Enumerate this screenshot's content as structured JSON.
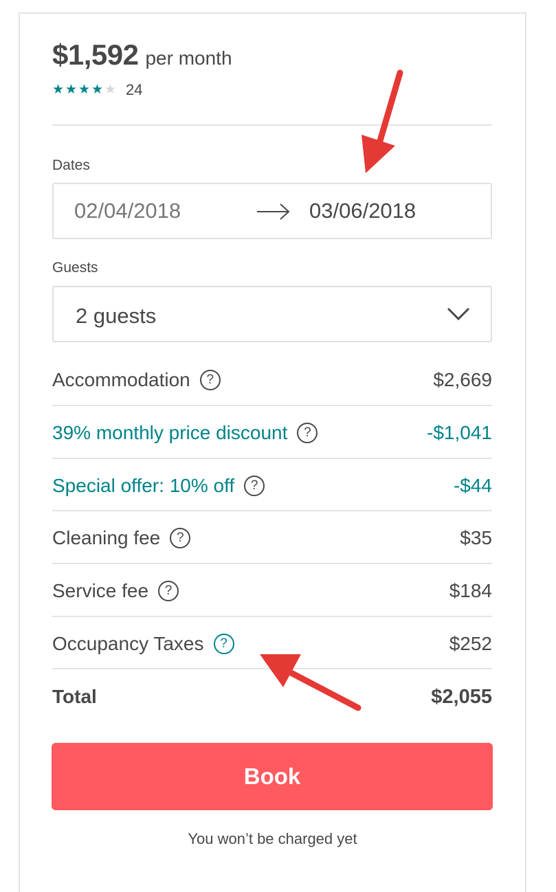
{
  "header": {
    "price": "$1,592",
    "price_unit": "per month",
    "rating": 4,
    "rating_max": 5,
    "review_count": "24"
  },
  "dates": {
    "label": "Dates",
    "check_in": "02/04/2018",
    "check_out": "03/06/2018"
  },
  "guests": {
    "label": "Guests",
    "value": "2 guests"
  },
  "line_items": [
    {
      "label": "Accommodation",
      "value": "$2,669"
    },
    {
      "label": "39% monthly price discount",
      "value": "-$1,041"
    },
    {
      "label": "Special offer: 10% off",
      "value": "-$44"
    },
    {
      "label": "Cleaning fee",
      "value": "$35"
    },
    {
      "label": "Service fee",
      "value": "$184"
    },
    {
      "label": "Occupancy Taxes",
      "value": "$252"
    }
  ],
  "total": {
    "label": "Total",
    "value": "$2,055"
  },
  "book_button": "Book",
  "note": "You won’t be charged yet",
  "colors": {
    "accent_teal": "#008489",
    "book_button": "#ff5a5f",
    "annotation_arrow": "#e53935"
  },
  "icons": {
    "star": "star-icon",
    "help": "question-circle-icon",
    "arrow": "arrow-right-icon",
    "chevron": "chevron-down-icon"
  }
}
